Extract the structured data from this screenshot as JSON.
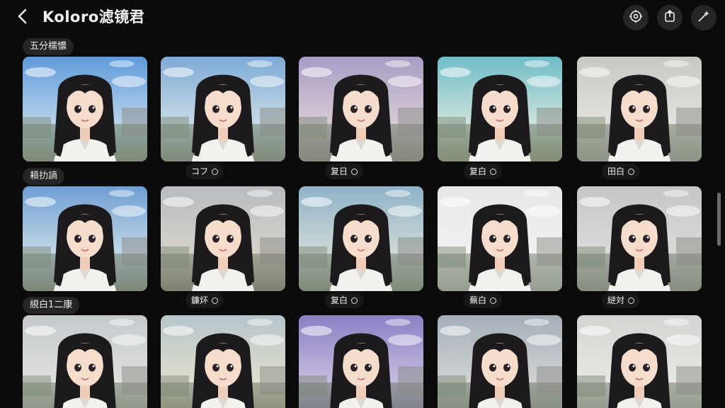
{
  "app": {
    "title": "Koloro滤镜君"
  },
  "header_icons": [
    "filter-settings-icon",
    "export-icon",
    "magic-wand-icon"
  ],
  "sections": [
    {
      "label": "五分檽憹"
    },
    {
      "label": "頛扐謪"
    },
    {
      "label": "絸白1二康"
    }
  ],
  "filters_row1": [
    "コフ",
    "复日",
    "复白",
    "田白"
  ],
  "filters_row2": [
    "鐮炋",
    "复白",
    "蕪白",
    "縌対"
  ],
  "colors": {
    "background": "#0b0b0b",
    "tile_tints": [
      "#6fa3d9",
      "#8bb6d8",
      "#b9a6c9",
      "#7fc2c9",
      "#cfcfcb"
    ]
  }
}
